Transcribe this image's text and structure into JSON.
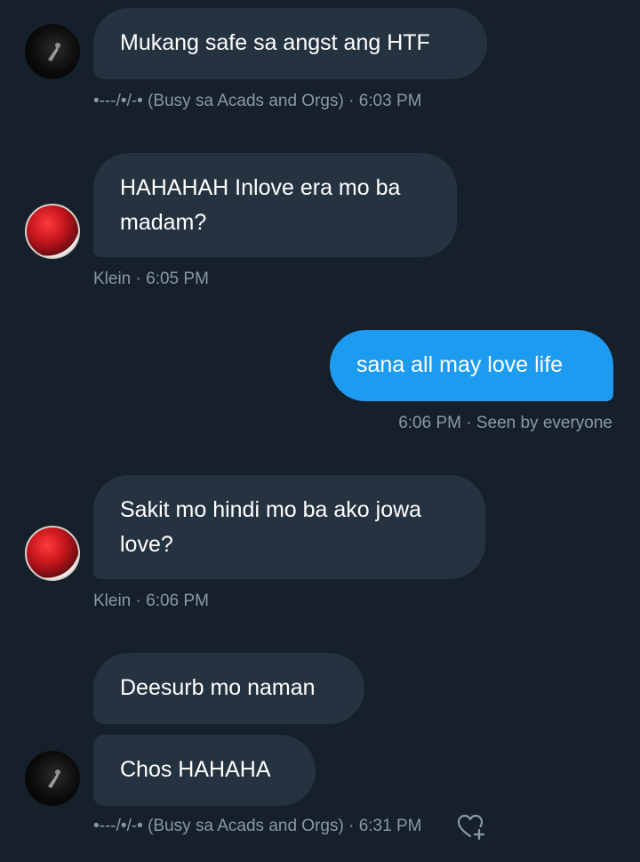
{
  "conversation": {
    "messages": [
      {
        "text": "Mukang safe sa angst ang HTF",
        "sender": "----/•/--• (Busy sa Acads and Orgs)",
        "time": "6:03 PM",
        "meta": "•---/•/-• (Busy sa Acads and Orgs) · 6:03 PM"
      },
      {
        "text": "HAHAHAH Inlove era mo ba madam?",
        "sender": "Klein",
        "time": "6:05 PM",
        "meta": "Klein · 6:05 PM"
      },
      {
        "text": "sana all may love life",
        "sender": "me",
        "time": "6:06 PM",
        "meta": "6:06 PM · Seen by everyone"
      },
      {
        "text": "Sakit mo hindi mo ba ako jowa love?",
        "sender": "Klein",
        "time": "6:06 PM",
        "meta": "Klein · 6:06 PM"
      },
      {
        "text": "Deesurb mo naman"
      },
      {
        "text": "Chos HAHAHA",
        "meta": "•---/•/-• (Busy sa Acads and Orgs) · 6:31 PM"
      }
    ]
  },
  "icons": {
    "avatar_1": "avatar-dark",
    "avatar_2": "avatar-red-hair",
    "react": "heart-plus-icon"
  },
  "colors": {
    "background": "#15202b",
    "incoming_bubble": "#253341",
    "outgoing_bubble": "#1d9bf0",
    "meta_text": "#8b98a5"
  }
}
